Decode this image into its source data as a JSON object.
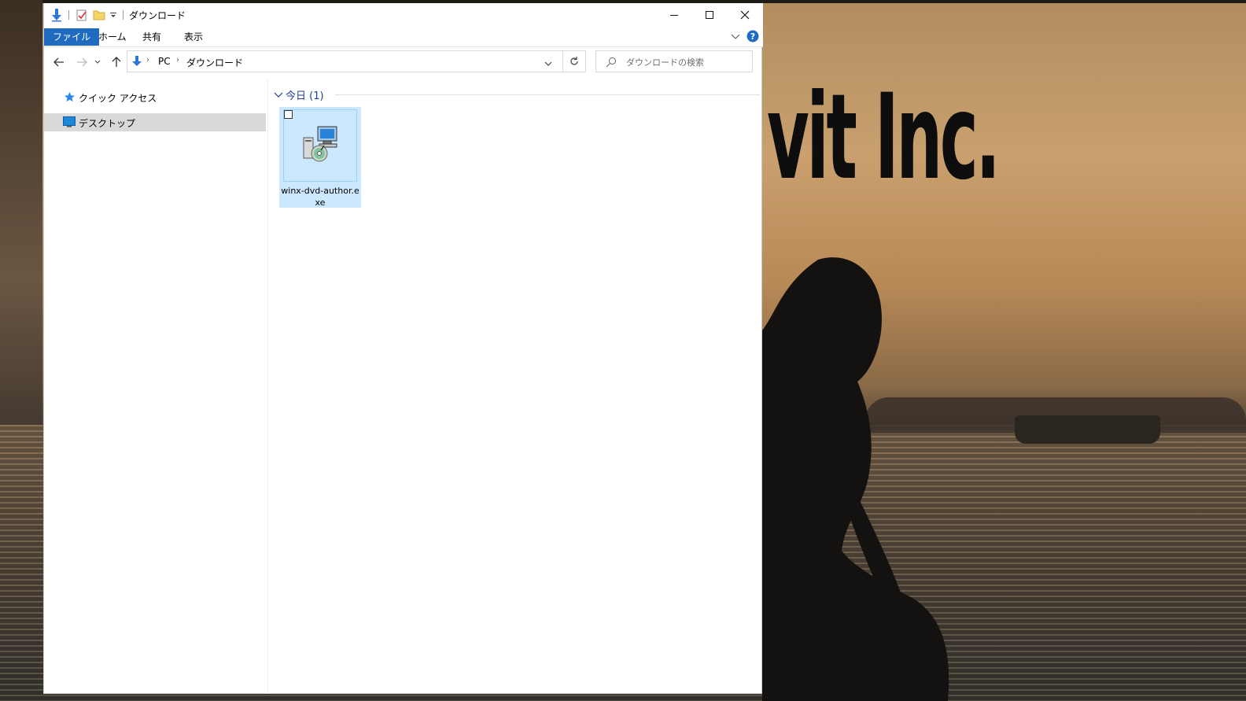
{
  "wallpaper": {
    "brand_text": "vit Inc."
  },
  "window": {
    "title": "ダウンロード",
    "controls": {
      "minimize_icon": "minimize-icon",
      "maximize_icon": "maximize-icon",
      "close_icon": "close-icon"
    }
  },
  "ribbon": {
    "tabs": [
      {
        "label": "ファイル",
        "active": true
      },
      {
        "label": "ホーム"
      },
      {
        "label": "共有"
      },
      {
        "label": "表示"
      }
    ]
  },
  "address": {
    "crumbs": [
      "PC",
      "ダウンロード"
    ]
  },
  "search": {
    "placeholder": "ダウンロードの検索"
  },
  "navpane": {
    "items": [
      {
        "label": "クイック アクセス",
        "icon": "star-icon"
      },
      {
        "label": "デスクトップ",
        "icon": "desktop-icon",
        "selected": true
      }
    ]
  },
  "content": {
    "group_label": "今日 (1)",
    "files": [
      {
        "name": "winx-dvd-author.exe",
        "icon": "installer-icon",
        "selected": true
      }
    ]
  },
  "colors": {
    "file_tab": "#1e6bbf",
    "selection": "#cce8ff",
    "group_text": "#1e3e8e",
    "help": "#1e6bbf"
  }
}
